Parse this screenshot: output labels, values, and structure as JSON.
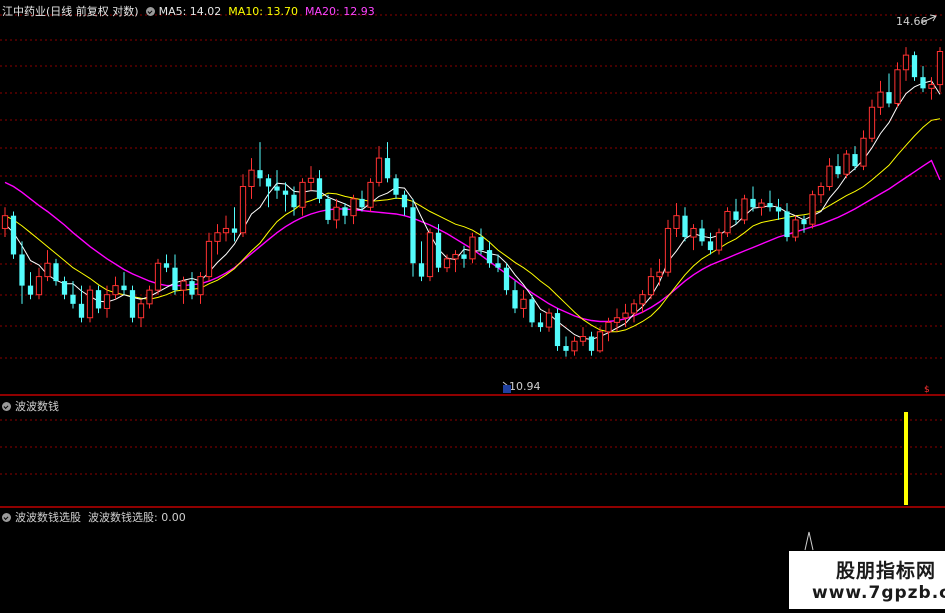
{
  "header": {
    "title": "江中药业(日线 前复权 对数)",
    "ma5_label": "MA5: 14.02",
    "ma10_label": "MA10: 13.70",
    "ma20_label": "MA20: 12.93"
  },
  "panel2": {
    "title": "波波数钱"
  },
  "panel3": {
    "title": "波波数钱选股",
    "value_label": "波波数钱选股: 0.00"
  },
  "annotations": {
    "high_label": "14.66",
    "low_label": "10.94"
  },
  "watermark": {
    "title": "股朋指标网",
    "url": "www.7gpzb.com"
  },
  "colors": {
    "up": "#ff3232",
    "down": "#54fcfc",
    "ma5": "#ffffff",
    "ma10": "#ffff00",
    "ma20": "#ff00ff",
    "grid": "#8b0000",
    "background": "#000000",
    "signal": "#ffff00"
  },
  "chart_data": {
    "type": "candlestick",
    "scale": "log",
    "price_range": [
      10.6,
      14.9
    ],
    "candles": [
      [
        12.35,
        12.6,
        12.25,
        12.5
      ],
      [
        12.5,
        12.55,
        12.0,
        12.05
      ],
      [
        12.05,
        12.2,
        11.5,
        11.7
      ],
      [
        11.7,
        11.85,
        11.55,
        11.6
      ],
      [
        11.6,
        11.9,
        11.55,
        11.8
      ],
      [
        11.8,
        12.1,
        11.75,
        11.95
      ],
      [
        11.95,
        12.0,
        11.7,
        11.75
      ],
      [
        11.75,
        11.8,
        11.55,
        11.6
      ],
      [
        11.6,
        11.75,
        11.45,
        11.5
      ],
      [
        11.5,
        11.7,
        11.3,
        11.35
      ],
      [
        11.35,
        11.7,
        11.3,
        11.65
      ],
      [
        11.65,
        11.7,
        11.4,
        11.45
      ],
      [
        11.45,
        11.7,
        11.35,
        11.6
      ],
      [
        11.6,
        11.8,
        11.55,
        11.7
      ],
      [
        11.7,
        11.85,
        11.6,
        11.65
      ],
      [
        11.65,
        11.7,
        11.3,
        11.35
      ],
      [
        11.35,
        11.55,
        11.25,
        11.5
      ],
      [
        11.5,
        11.7,
        11.45,
        11.65
      ],
      [
        11.65,
        12.0,
        11.6,
        11.95
      ],
      [
        11.95,
        12.05,
        11.85,
        11.9
      ],
      [
        11.9,
        12.05,
        11.6,
        11.65
      ],
      [
        11.65,
        11.8,
        11.5,
        11.75
      ],
      [
        11.75,
        11.85,
        11.55,
        11.6
      ],
      [
        11.6,
        11.85,
        11.5,
        11.8
      ],
      [
        11.8,
        12.3,
        11.75,
        12.2
      ],
      [
        12.2,
        12.4,
        12.05,
        12.3
      ],
      [
        12.3,
        12.5,
        12.2,
        12.35
      ],
      [
        12.35,
        12.6,
        12.2,
        12.3
      ],
      [
        12.3,
        13.0,
        12.25,
        12.85
      ],
      [
        12.85,
        13.2,
        12.7,
        13.05
      ],
      [
        13.05,
        13.4,
        12.85,
        12.95
      ],
      [
        12.95,
        13.0,
        12.6,
        12.85
      ],
      [
        12.85,
        13.05,
        12.7,
        12.8
      ],
      [
        12.8,
        12.9,
        12.55,
        12.75
      ],
      [
        12.75,
        12.85,
        12.5,
        12.6
      ],
      [
        12.6,
        12.95,
        12.5,
        12.9
      ],
      [
        12.9,
        13.1,
        12.8,
        12.95
      ],
      [
        12.95,
        13.05,
        12.65,
        12.7
      ],
      [
        12.7,
        12.75,
        12.4,
        12.45
      ],
      [
        12.45,
        12.7,
        12.35,
        12.6
      ],
      [
        12.6,
        12.65,
        12.4,
        12.5
      ],
      [
        12.5,
        12.75,
        12.4,
        12.7
      ],
      [
        12.7,
        12.8,
        12.55,
        12.6
      ],
      [
        12.6,
        12.95,
        12.55,
        12.9
      ],
      [
        12.9,
        13.35,
        12.85,
        13.2
      ],
      [
        13.2,
        13.4,
        12.9,
        12.95
      ],
      [
        12.95,
        13.0,
        12.7,
        12.75
      ],
      [
        12.75,
        12.8,
        12.5,
        12.6
      ],
      [
        12.6,
        12.7,
        11.8,
        11.95
      ],
      [
        11.95,
        12.2,
        11.75,
        11.8
      ],
      [
        11.8,
        12.35,
        11.75,
        12.3
      ],
      [
        12.3,
        12.4,
        11.85,
        11.9
      ],
      [
        11.9,
        12.05,
        11.85,
        12.0
      ],
      [
        12.0,
        12.1,
        11.85,
        12.05
      ],
      [
        12.05,
        12.15,
        11.9,
        12.0
      ],
      [
        12.0,
        12.3,
        11.95,
        12.25
      ],
      [
        12.25,
        12.35,
        12.05,
        12.1
      ],
      [
        12.1,
        12.2,
        11.9,
        11.95
      ],
      [
        11.95,
        12.05,
        11.85,
        11.9
      ],
      [
        11.9,
        11.95,
        11.6,
        11.65
      ],
      [
        11.65,
        11.75,
        11.4,
        11.45
      ],
      [
        11.45,
        11.65,
        11.35,
        11.55
      ],
      [
        11.55,
        11.6,
        11.25,
        11.3
      ],
      [
        11.3,
        11.4,
        11.2,
        11.25
      ],
      [
        11.25,
        11.45,
        11.2,
        11.4
      ],
      [
        11.4,
        11.45,
        11.0,
        11.05
      ],
      [
        11.05,
        11.15,
        10.94,
        11.0
      ],
      [
        11.0,
        11.15,
        10.95,
        11.1
      ],
      [
        11.1,
        11.25,
        11.05,
        11.15
      ],
      [
        11.15,
        11.2,
        10.95,
        11.0
      ],
      [
        11.0,
        11.25,
        10.98,
        11.2
      ],
      [
        11.2,
        11.35,
        11.1,
        11.3
      ],
      [
        11.3,
        11.45,
        11.2,
        11.35
      ],
      [
        11.35,
        11.5,
        11.25,
        11.4
      ],
      [
        11.4,
        11.55,
        11.3,
        11.5
      ],
      [
        11.5,
        11.65,
        11.4,
        11.6
      ],
      [
        11.6,
        11.9,
        11.55,
        11.8
      ],
      [
        11.8,
        12.0,
        11.7,
        11.85
      ],
      [
        11.85,
        12.45,
        11.8,
        12.35
      ],
      [
        12.35,
        12.65,
        12.25,
        12.5
      ],
      [
        12.5,
        12.6,
        12.2,
        12.25
      ],
      [
        12.25,
        12.4,
        12.1,
        12.35
      ],
      [
        12.35,
        12.45,
        12.15,
        12.2
      ],
      [
        12.2,
        12.3,
        12.05,
        12.1
      ],
      [
        12.1,
        12.35,
        12.05,
        12.3
      ],
      [
        12.3,
        12.6,
        12.25,
        12.55
      ],
      [
        12.55,
        12.7,
        12.4,
        12.45
      ],
      [
        12.45,
        12.75,
        12.4,
        12.7
      ],
      [
        12.7,
        12.85,
        12.55,
        12.6
      ],
      [
        12.6,
        12.7,
        12.5,
        12.65
      ],
      [
        12.65,
        12.8,
        12.55,
        12.6
      ],
      [
        12.6,
        12.7,
        12.45,
        12.55
      ],
      [
        12.55,
        12.65,
        12.2,
        12.25
      ],
      [
        12.25,
        12.5,
        12.2,
        12.45
      ],
      [
        12.45,
        12.5,
        12.3,
        12.4
      ],
      [
        12.4,
        12.8,
        12.35,
        12.75
      ],
      [
        12.75,
        12.9,
        12.65,
        12.85
      ],
      [
        12.85,
        13.2,
        12.8,
        13.1
      ],
      [
        13.1,
        13.25,
        12.95,
        13.0
      ],
      [
        13.0,
        13.3,
        12.95,
        13.25
      ],
      [
        13.25,
        13.35,
        13.05,
        13.1
      ],
      [
        13.1,
        13.55,
        13.05,
        13.45
      ],
      [
        13.45,
        13.95,
        13.4,
        13.85
      ],
      [
        13.85,
        14.2,
        13.75,
        14.05
      ],
      [
        14.05,
        14.3,
        13.85,
        13.9
      ],
      [
        13.9,
        14.45,
        13.85,
        14.35
      ],
      [
        14.35,
        14.66,
        14.2,
        14.55
      ],
      [
        14.55,
        14.6,
        14.2,
        14.25
      ],
      [
        14.25,
        14.4,
        14.05,
        14.1
      ],
      [
        14.1,
        14.25,
        13.95,
        14.15
      ],
      [
        14.15,
        14.66,
        14.05,
        14.6
      ]
    ],
    "ma5": [
      12.4,
      12.3,
      12.15,
      11.98,
      11.93,
      11.82,
      11.76,
      11.72,
      11.72,
      11.64,
      11.58,
      11.53,
      11.52,
      11.55,
      11.6,
      11.57,
      11.55,
      11.58,
      11.63,
      11.68,
      11.73,
      11.76,
      11.78,
      11.75,
      11.85,
      11.96,
      12.05,
      12.17,
      12.34,
      12.52,
      12.6,
      12.76,
      12.89,
      12.88,
      12.79,
      12.78,
      12.8,
      12.79,
      12.72,
      12.68,
      12.64,
      12.59,
      12.57,
      12.65,
      12.73,
      12.77,
      12.84,
      12.83,
      12.69,
      12.48,
      12.28,
      12.11,
      12.01,
      11.99,
      12.11,
      12.09,
      12.09,
      12.06,
      12.04,
      11.95,
      11.82,
      11.71,
      11.58,
      11.44,
      11.39,
      11.31,
      11.24,
      11.17,
      11.13,
      11.12,
      11.15,
      11.19,
      11.24,
      11.29,
      11.39,
      11.47,
      11.58,
      11.74,
      11.97,
      12.09,
      12.23,
      12.29,
      12.26,
      12.24,
      12.27,
      12.34,
      12.4,
      12.5,
      12.59,
      12.6,
      12.62,
      12.6,
      12.54,
      12.5,
      12.45,
      12.5,
      12.55,
      12.71,
      12.83,
      12.98,
      13.07,
      13.18,
      13.33,
      13.51,
      13.65,
      13.86,
      14.03,
      14.12,
      14.17,
      14.2,
      14.02
    ],
    "ma10": [
      12.5,
      12.45,
      12.38,
      12.3,
      12.22,
      12.14,
      12.06,
      11.98,
      11.9,
      11.84,
      11.78,
      11.71,
      11.65,
      11.62,
      11.6,
      11.58,
      11.56,
      11.55,
      11.57,
      11.6,
      11.64,
      11.65,
      11.66,
      11.67,
      11.72,
      11.76,
      11.82,
      11.89,
      11.99,
      12.09,
      12.18,
      12.31,
      12.43,
      12.51,
      12.57,
      12.65,
      12.68,
      12.72,
      12.77,
      12.76,
      12.73,
      12.71,
      12.69,
      12.67,
      12.68,
      12.69,
      12.71,
      12.7,
      12.67,
      12.61,
      12.55,
      12.5,
      12.45,
      12.4,
      12.37,
      12.33,
      12.27,
      12.19,
      12.1,
      12.03,
      11.96,
      11.9,
      11.83,
      11.75,
      11.68,
      11.59,
      11.5,
      11.41,
      11.33,
      11.27,
      11.22,
      11.2,
      11.2,
      11.22,
      11.26,
      11.31,
      11.37,
      11.46,
      11.58,
      11.7,
      11.82,
      11.92,
      12.0,
      12.06,
      12.12,
      12.18,
      12.23,
      12.3,
      12.38,
      12.42,
      12.44,
      12.46,
      12.48,
      12.5,
      12.51,
      12.53,
      12.56,
      12.62,
      12.68,
      12.74,
      12.79,
      12.85,
      12.93,
      13.02,
      13.11,
      13.24,
      13.36,
      13.48,
      13.59,
      13.68,
      13.7
    ],
    "ma20": [
      12.9,
      12.85,
      12.78,
      12.7,
      12.62,
      12.55,
      12.47,
      12.39,
      12.3,
      12.22,
      12.14,
      12.07,
      12.0,
      11.94,
      11.88,
      11.83,
      11.79,
      11.75,
      11.72,
      11.7,
      11.7,
      11.7,
      11.71,
      11.72,
      11.75,
      11.79,
      11.84,
      11.9,
      11.98,
      12.06,
      12.14,
      12.22,
      12.3,
      12.37,
      12.43,
      12.48,
      12.52,
      12.55,
      12.57,
      12.58,
      12.58,
      12.57,
      12.56,
      12.55,
      12.54,
      12.53,
      12.52,
      12.5,
      12.47,
      12.43,
      12.39,
      12.34,
      12.29,
      12.23,
      12.17,
      12.11,
      12.04,
      11.97,
      11.9,
      11.83,
      11.76,
      11.69,
      11.62,
      11.56,
      11.5,
      11.45,
      11.41,
      11.37,
      11.34,
      11.32,
      11.31,
      11.31,
      11.32,
      11.34,
      11.37,
      11.41,
      11.46,
      11.52,
      11.59,
      11.67,
      11.75,
      11.82,
      11.88,
      11.93,
      11.97,
      12.01,
      12.05,
      12.09,
      12.13,
      12.17,
      12.21,
      12.25,
      12.28,
      12.31,
      12.34,
      12.37,
      12.4,
      12.44,
      12.48,
      12.53,
      12.58,
      12.64,
      12.7,
      12.76,
      12.82,
      12.89,
      12.96,
      13.03,
      13.1,
      13.17,
      12.93
    ],
    "signal_index": 106,
    "signal_value": 0.0
  }
}
